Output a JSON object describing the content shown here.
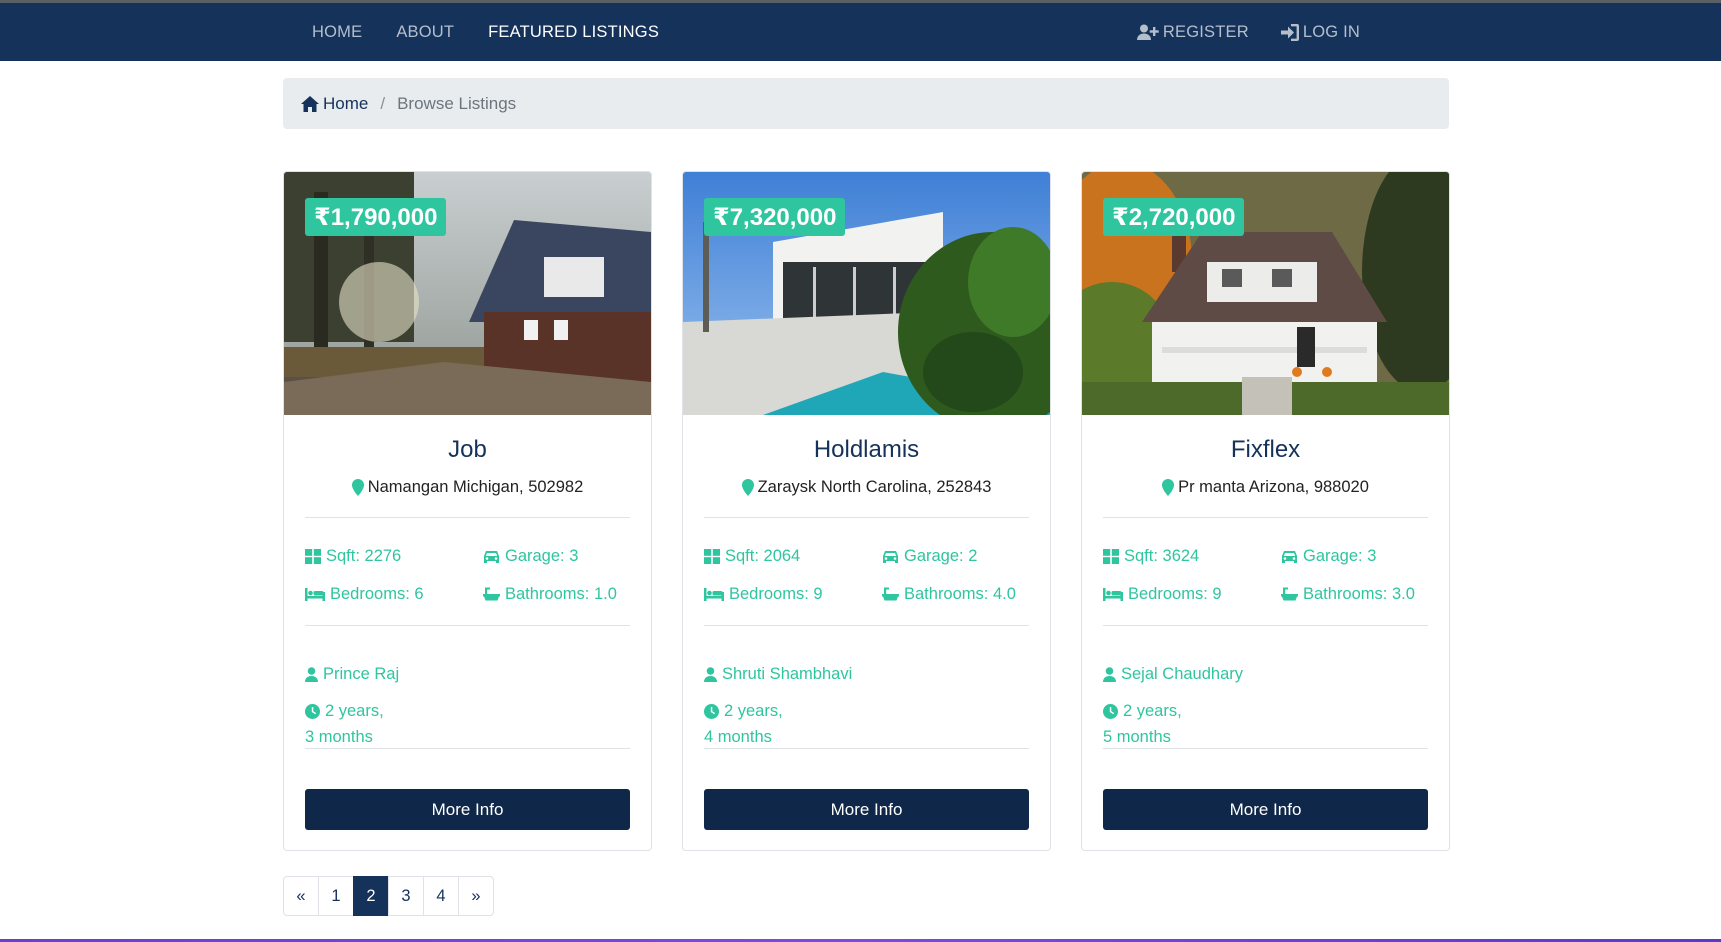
{
  "nav": {
    "items": [
      "HOME",
      "ABOUT",
      "FEATURED LISTINGS"
    ],
    "active_index": 2,
    "register": "REGISTER",
    "login": "LOG IN"
  },
  "breadcrumb": {
    "home": "Home",
    "separator": "/",
    "current": "Browse Listings"
  },
  "listings": [
    {
      "price": "₹1,790,000",
      "title": "Job",
      "address": "Namangan Michigan, 502982",
      "sqft": "Sqft: 2276",
      "garage": "Garage: 3",
      "bedrooms": "Bedrooms: 6",
      "bathrooms": "Bathrooms: 1.0",
      "agent": "Prince Raj",
      "time_line1": "2 years,",
      "time_line2": "3 months",
      "button": "More Info"
    },
    {
      "price": "₹7,320,000",
      "title": "Holdlamis",
      "address": "Zaraysk North Carolina, 252843",
      "sqft": "Sqft: 2064",
      "garage": "Garage: 2",
      "bedrooms": "Bedrooms: 9",
      "bathrooms": "Bathrooms: 4.0",
      "agent": "Shruti Shambhavi",
      "time_line1": "2 years,",
      "time_line2": "4 months",
      "button": "More Info"
    },
    {
      "price": "₹2,720,000",
      "title": "Fixflex",
      "address": "Pr manta Arizona, 988020",
      "sqft": "Sqft: 3624",
      "garage": "Garage: 3",
      "bedrooms": "Bedrooms: 9",
      "bathrooms": "Bathrooms: 3.0",
      "agent": "Sejal Chaudhary",
      "time_line1": "2 years,",
      "time_line2": "5 months",
      "button": "More Info"
    }
  ],
  "pagination": {
    "prev": "«",
    "pages": [
      "1",
      "2",
      "3",
      "4"
    ],
    "active": "2",
    "next": "»"
  },
  "colors": {
    "navbar": "#15325a",
    "accent": "#2fc59f",
    "button": "#0f2749"
  }
}
